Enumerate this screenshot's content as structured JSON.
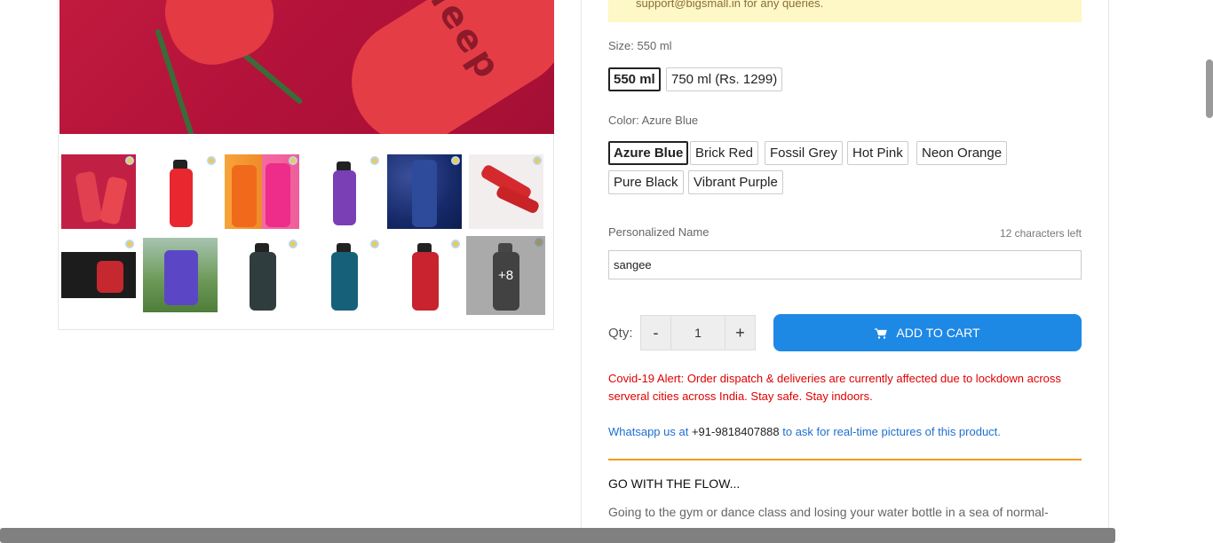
{
  "notice": {
    "text": "support@bigsmall.in for any queries."
  },
  "gallery": {
    "more_count": "+8",
    "thumbnails": [
      "red bottles on pink",
      "red bottle",
      "orange and pink bottles",
      "purple bottle",
      "blue bottle in blueberries",
      "red bottles with roses",
      "black bottle",
      "purple bottle on grass",
      "grey bottle",
      "teal bottle",
      "red bottle",
      "black bottle"
    ]
  },
  "size": {
    "label": "Size: 550 ml",
    "options": [
      "550 ml",
      "750 ml (Rs. 1299)"
    ],
    "selected": "550 ml"
  },
  "color": {
    "label": "Color: Azure Blue",
    "options": [
      "Azure Blue",
      "Brick Red",
      "Fossil Grey",
      "Hot Pink",
      "Neon Orange",
      "Pure Black",
      "Vibrant Purple"
    ],
    "selected": "Azure Blue"
  },
  "personalize": {
    "label": "Personalized Name",
    "chars_left": "12 characters left",
    "value": "sangee"
  },
  "qty": {
    "label": "Qty:",
    "minus": "-",
    "value": "1",
    "plus": "+"
  },
  "cart": {
    "label": "ADD TO CART",
    "icon": "cart-icon",
    "color": "#1e88e5"
  },
  "covid_alert": "Covid-19 Alert: Order dispatch & deliveries are currently affected due to lockdown across serveral cities across India. Stay safe. Stay indoors.",
  "whatsapp": {
    "prefix": "Whatsapp us at ",
    "number": "+91-9818407888",
    "suffix": " to ask for real-time pictures of this product."
  },
  "description": {
    "title": "GO WITH THE FLOW...",
    "text": "Going to the gym or dance class and losing your water bottle in a sea of normal-"
  }
}
